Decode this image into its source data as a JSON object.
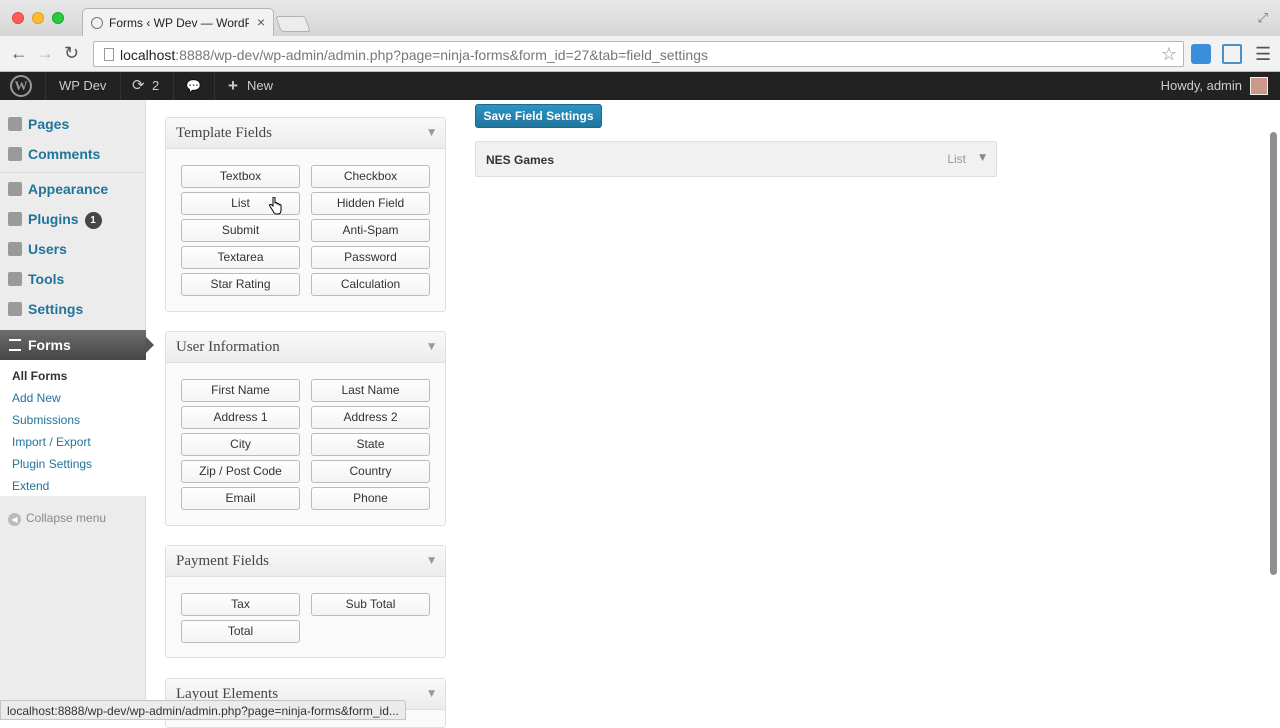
{
  "browser": {
    "tab_title": "Forms ‹ WP Dev — WordPress",
    "tab_close": "×",
    "url_host": "localhost",
    "url_rest": ":8888/wp-dev/wp-admin/admin.php?page=ninja-forms&form_id=27&tab=field_settings",
    "back": "←",
    "forward": "→",
    "reload": "↻",
    "star": "☆",
    "menu": "☰",
    "fullscreen": "⤢"
  },
  "adminbar": {
    "logo": "W",
    "site_name": "WP Dev",
    "updates_count": "2",
    "updates_icon": "⟳",
    "comments_icon": "💬",
    "new_icon": "+",
    "new_label": "New",
    "howdy": "Howdy, admin"
  },
  "sidebar": {
    "items": [
      {
        "label": "Pages",
        "icon": "pages-icon"
      },
      {
        "label": "Comments",
        "icon": "comments-icon"
      },
      {
        "label": "Appearance",
        "icon": "appearance-icon"
      },
      {
        "label": "Plugins",
        "icon": "plugins-icon",
        "badge": "1"
      },
      {
        "label": "Users",
        "icon": "users-icon"
      },
      {
        "label": "Tools",
        "icon": "tools-icon"
      },
      {
        "label": "Settings",
        "icon": "settings-icon"
      }
    ],
    "active": {
      "label": "Forms",
      "icon": "forms-icon"
    },
    "submenu": [
      "All Forms",
      "Add New",
      "Submissions",
      "Import / Export",
      "Plugin Settings",
      "Extend"
    ],
    "collapse_label": "Collapse menu",
    "collapse_icon": "◀"
  },
  "boxes": {
    "template": {
      "title": "Template Fields",
      "buttons": [
        "Textbox",
        "Checkbox",
        "List",
        "Hidden Field",
        "Submit",
        "Anti-Spam",
        "Textarea",
        "Password",
        "Star Rating",
        "Calculation"
      ]
    },
    "user_info": {
      "title": "User Information",
      "buttons": [
        "First Name",
        "Last Name",
        "Address 1",
        "Address 2",
        "City",
        "State",
        "Zip / Post Code",
        "Country",
        "Email",
        "Phone"
      ]
    },
    "payment": {
      "title": "Payment Fields",
      "buttons": [
        "Tax",
        "Sub Total",
        "Total"
      ]
    },
    "layout": {
      "title": "Layout Elements"
    },
    "toggle_arrow": "▼"
  },
  "main": {
    "save_label": "Save Field Settings",
    "field_name": "NES Games",
    "field_type": "List",
    "field_arrow": "▼"
  },
  "status_url": "localhost:8888/wp-dev/wp-admin/admin.php?page=ninja-forms&form_id..."
}
